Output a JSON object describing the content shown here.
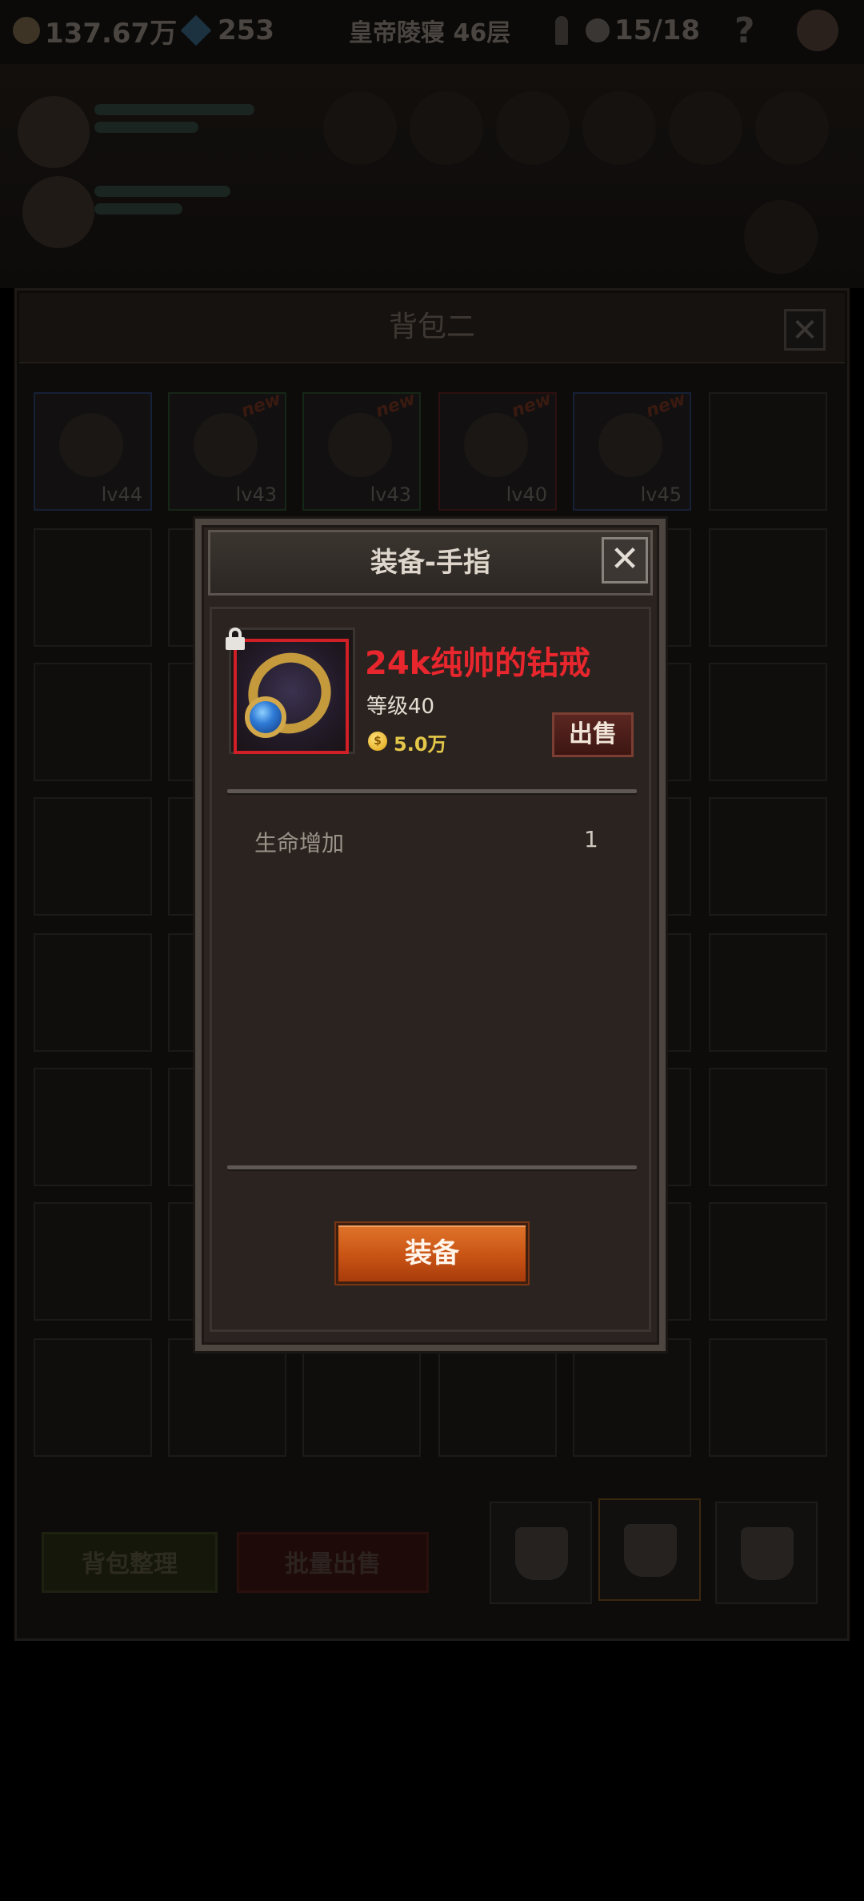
{
  "topbar": {
    "coins": "137.67万",
    "gems": "253",
    "location": "皇帝陵寝 46层",
    "skulls": "15/18",
    "help": "?"
  },
  "bag": {
    "title": "背包二",
    "close": "✕",
    "items": [
      {
        "level": "lv44",
        "rarity": "blue",
        "new": "",
        "icon": "ring-icon"
      },
      {
        "level": "lv43",
        "rarity": "green",
        "new": "new",
        "icon": "gauntlet-icon"
      },
      {
        "level": "lv43",
        "rarity": "green",
        "new": "new",
        "icon": "gauntlet-icon"
      },
      {
        "level": "lv40",
        "rarity": "red",
        "new": "new",
        "icon": "ring-icon"
      },
      {
        "level": "lv45",
        "rarity": "blue",
        "new": "new",
        "icon": "bracer-icon"
      }
    ],
    "sort_button": "背包整理",
    "bulk_sell_button": "批量出售"
  },
  "dialog": {
    "title": "装备-手指",
    "close": "✕",
    "item": {
      "name": "24k纯帅的钻戒",
      "level": "等级40",
      "price": "5.0万",
      "coin_glyph": "$"
    },
    "sell_button": "出售",
    "stats": [
      {
        "name": "生命增加",
        "value": "1"
      }
    ],
    "equip_button": "装备"
  },
  "colors": {
    "item_name": "#e8262d",
    "price": "#e5c84a",
    "equip_button": "#c85314"
  }
}
